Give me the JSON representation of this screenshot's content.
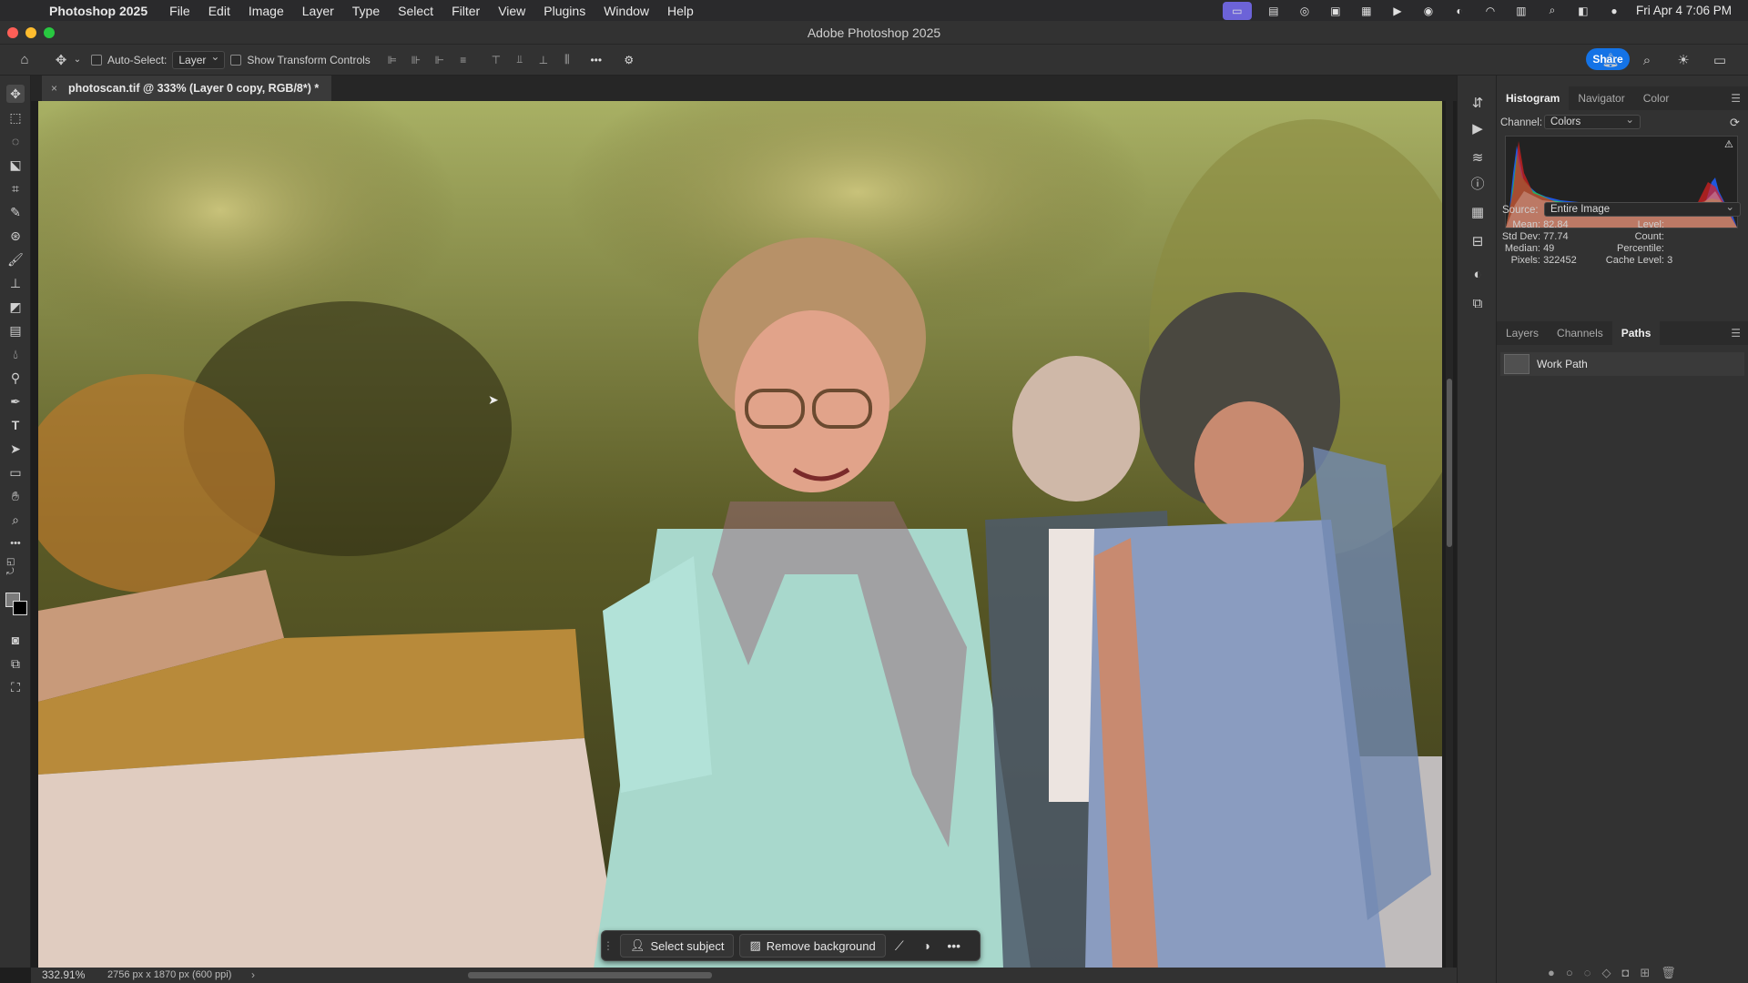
{
  "menubar": {
    "app_name": "Photoshop 2025",
    "items": [
      "File",
      "Edit",
      "Image",
      "Layer",
      "Type",
      "Select",
      "Filter",
      "View",
      "Plugins",
      "Window",
      "Help"
    ],
    "clock": "Fri Apr 4  7:06 PM"
  },
  "window": {
    "title": "Adobe Photoshop 2025"
  },
  "options": {
    "auto_select_label": "Auto-Select:",
    "auto_select_value": "Layer",
    "transform_label": "Show Transform Controls",
    "share_label": "Share"
  },
  "document": {
    "tab_label": "photoscan.tif @ 333% (Layer 0 copy, RGB/8*) *"
  },
  "taskbar": {
    "select_subject": "Select subject",
    "remove_background": "Remove background"
  },
  "statusbar": {
    "zoom": "332.91%",
    "dimensions": "2756 px x 1870 px (600 ppi)"
  },
  "histogram_panel": {
    "tabs": [
      "Histogram",
      "Navigator",
      "Color"
    ],
    "channel_label": "Channel:",
    "channel_value": "Colors",
    "source_label": "Source:",
    "source_value": "Entire Image",
    "stats_left": [
      {
        "label": "Mean:",
        "value": "82.84"
      },
      {
        "label": "Std Dev:",
        "value": "77.74"
      },
      {
        "label": "Median:",
        "value": "49"
      },
      {
        "label": "Pixels:",
        "value": "322452"
      }
    ],
    "stats_right": [
      {
        "label": "Level:",
        "value": ""
      },
      {
        "label": "Count:",
        "value": ""
      },
      {
        "label": "Percentile:",
        "value": ""
      },
      {
        "label": "Cache Level:",
        "value": "3"
      }
    ]
  },
  "paths_panel": {
    "tabs": [
      "Layers",
      "Channels",
      "Paths"
    ],
    "items": [
      "Work Path"
    ]
  },
  "colors": {
    "accent": "#1473e6",
    "histogram_red": "#e02020",
    "histogram_green": "#20d040",
    "histogram_blue": "#2060ff"
  }
}
